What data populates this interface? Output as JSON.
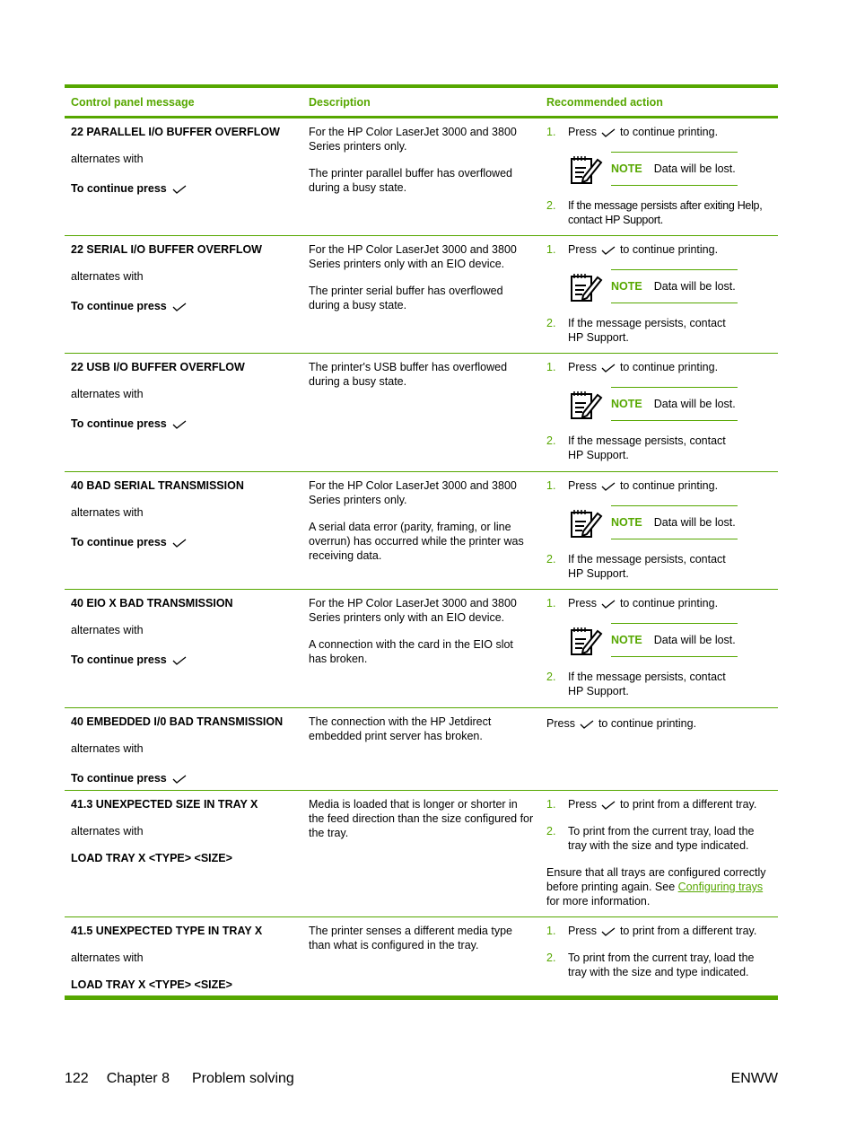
{
  "table": {
    "headers": [
      "Control panel message",
      "Description",
      "Recommended action"
    ],
    "rows": [
      {
        "message": "22 PARALLEL I/O BUFFER OVERFLOW",
        "alternates": "alternates with",
        "second": "To continue press",
        "second_has_check": true,
        "description": [
          "For the HP Color LaserJet 3000 and 3800 Series printers only.",
          "The printer parallel buffer has overflowed during a busy state."
        ],
        "step1_pre": "Press",
        "step1_post": "to continue printing.",
        "note_label": "NOTE",
        "note_text": "Data will be lost.",
        "step2": "If the message persists after exiting Help, contact HP Support."
      },
      {
        "message": "22 SERIAL I/O BUFFER OVERFLOW",
        "alternates": "alternates with",
        "second": "To continue press",
        "description": [
          "For the HP Color LaserJet 3000 and 3800 Series printers only with an EIO device.",
          "The printer serial buffer has overflowed during a busy state."
        ],
        "step1_pre": "Press",
        "step1_post": "to continue printing.",
        "note_label": "NOTE",
        "note_text": "Data will be lost.",
        "step2": "If the message persists, contact HP Support."
      },
      {
        "message": "22 USB I/O BUFFER OVERFLOW",
        "alternates": "alternates with",
        "second": "To continue press",
        "description": [
          "The printer's USB buffer has overflowed during a busy state."
        ],
        "step1_pre": "Press",
        "step1_post": "to continue printing.",
        "note_label": "NOTE",
        "note_text": "Data will be lost.",
        "step2": "If the message persists, contact HP Support."
      },
      {
        "message": "40 BAD SERIAL TRANSMISSION",
        "alternates": "alternates with",
        "second": "To continue press",
        "description": [
          "For the HP Color LaserJet 3000 and 3800 Series printers only.",
          "A serial data error (parity, framing, or line overrun) has occurred while the printer was receiving data."
        ],
        "step1_pre": "Press",
        "step1_post": "to continue printing.",
        "note_label": "NOTE",
        "note_text": "Data will be lost.",
        "step2": "If the message persists, contact HP Support."
      },
      {
        "message": "40 EIO X BAD TRANSMISSION",
        "alternates": "alternates with",
        "second": "To continue press",
        "description": [
          "For the HP Color LaserJet 3000 and 3800 Series printers only with an EIO device.",
          "A connection with the card in the EIO slot has broken."
        ],
        "step1_pre": "Press",
        "step1_post": "to continue printing.",
        "note_label": "NOTE",
        "note_text": "Data will be lost.",
        "step2": "If the message persists, contact HP Support."
      },
      {
        "message": "40 EMBEDDED I/0 BAD TRANSMISSION",
        "alternates": "alternates with",
        "second": "To continue press",
        "description": [
          "The connection with the HP Jetdirect embedded print server has broken."
        ],
        "action_pre": "Press",
        "action_post": "to continue printing."
      },
      {
        "message": "41.3 UNEXPECTED SIZE IN TRAY X",
        "alternates": "alternates with",
        "second": "LOAD TRAY X <TYPE> <SIZE>",
        "description": [
          "Media is loaded that is longer or shorter in the feed direction than the size configured for the tray."
        ],
        "step1_pre": "Press",
        "step1_post": "to print from a different tray.",
        "step2": "To print from the current tray, load the tray with the size and type indicated.",
        "para_pre": "Ensure that all trays are configured correctly before printing again. See",
        "para_link": "Configuring trays",
        "para_post": "for more information."
      },
      {
        "message": "41.5 UNEXPECTED TYPE IN TRAY X",
        "alternates": "alternates with",
        "second": "LOAD TRAY X <TYPE> <SIZE>",
        "description": [
          "The printer senses a different media type than what is configured in the tray."
        ],
        "step1_pre": "Press",
        "step1_post": "to print from a different tray.",
        "step2": "To print from the current tray, load the tray with the size and type indicated."
      }
    ]
  },
  "step_numbers": [
    "1.",
    "2."
  ],
  "icons": {
    "check": "checkmark-icon",
    "note": "note-pencil-icon"
  },
  "colors": {
    "accent": "#56a700"
  },
  "footer": {
    "page": "122",
    "chapter": "Chapter 8",
    "section": "Problem solving",
    "locale": "ENWW"
  }
}
